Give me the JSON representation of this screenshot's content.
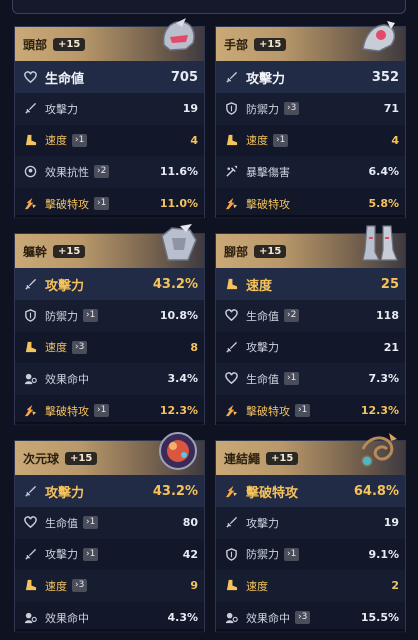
{
  "colors": {
    "gold": "#f6c35b",
    "main_bg": "#222b45",
    "card_bg": "#171d31"
  },
  "cards": [
    {
      "slot": "頭部",
      "level": "+15",
      "relic_icon": "helmet-icon",
      "main": {
        "icon": "heart-icon",
        "name": "生命値",
        "value": "705",
        "gold": false
      },
      "subs": [
        {
          "icon": "sword-icon",
          "name": "攻擊力",
          "roll": "",
          "value": "19",
          "gold": false
        },
        {
          "icon": "boot-icon",
          "name": "速度",
          "roll": "›1",
          "value": "4",
          "gold": true
        },
        {
          "icon": "resist-icon",
          "name": "效果抗性",
          "roll": "›2",
          "value": "11.6%",
          "gold": false
        },
        {
          "icon": "break-icon",
          "name": "擊破特攻",
          "roll": "›1",
          "value": "11.0%",
          "gold": true
        }
      ]
    },
    {
      "slot": "手部",
      "level": "+15",
      "relic_icon": "gauntlet-icon",
      "main": {
        "icon": "sword-icon",
        "name": "攻擊力",
        "value": "352",
        "gold": false
      },
      "subs": [
        {
          "icon": "shield-icon",
          "name": "防禦力",
          "roll": "›3",
          "value": "71",
          "gold": false
        },
        {
          "icon": "boot-icon",
          "name": "速度",
          "roll": "›1",
          "value": "4",
          "gold": true
        },
        {
          "icon": "crit-icon",
          "name": "暴擊傷害",
          "roll": "",
          "value": "6.4%",
          "gold": false
        },
        {
          "icon": "break-icon",
          "name": "擊破特攻",
          "roll": "",
          "value": "5.8%",
          "gold": true
        }
      ]
    },
    {
      "slot": "軀幹",
      "level": "+15",
      "relic_icon": "armor-icon",
      "main": {
        "icon": "sword-icon",
        "name": "攻擊力",
        "value": "43.2%",
        "gold": true
      },
      "subs": [
        {
          "icon": "shield-icon",
          "name": "防禦力",
          "roll": "›1",
          "value": "10.8%",
          "gold": false
        },
        {
          "icon": "boot-icon",
          "name": "速度",
          "roll": "›3",
          "value": "8",
          "gold": true
        },
        {
          "icon": "hit-icon",
          "name": "效果命中",
          "roll": "",
          "value": "3.4%",
          "gold": false
        },
        {
          "icon": "break-icon",
          "name": "擊破特攻",
          "roll": "›1",
          "value": "12.3%",
          "gold": true
        }
      ]
    },
    {
      "slot": "腳部",
      "level": "+15",
      "relic_icon": "boots-icon",
      "main": {
        "icon": "boot-icon",
        "name": "速度",
        "value": "25",
        "gold": true
      },
      "subs": [
        {
          "icon": "heart-icon",
          "name": "生命值",
          "roll": "›2",
          "value": "118",
          "gold": false
        },
        {
          "icon": "sword-icon",
          "name": "攻擊力",
          "roll": "",
          "value": "21",
          "gold": false
        },
        {
          "icon": "heart-icon",
          "name": "生命值",
          "roll": "›1",
          "value": "7.3%",
          "gold": false
        },
        {
          "icon": "break-icon",
          "name": "擊破特攻",
          "roll": "›1",
          "value": "12.3%",
          "gold": true
        }
      ]
    },
    {
      "slot": "次元球",
      "level": "+15",
      "relic_icon": "sphere-icon",
      "main": {
        "icon": "sword-icon",
        "name": "攻擊力",
        "value": "43.2%",
        "gold": true
      },
      "subs": [
        {
          "icon": "heart-icon",
          "name": "生命值",
          "roll": "›1",
          "value": "80",
          "gold": false
        },
        {
          "icon": "sword-icon",
          "name": "攻擊力",
          "roll": "›1",
          "value": "42",
          "gold": false
        },
        {
          "icon": "boot-icon",
          "name": "速度",
          "roll": "›3",
          "value": "9",
          "gold": true
        },
        {
          "icon": "hit-icon",
          "name": "效果命中",
          "roll": "",
          "value": "4.3%",
          "gold": false
        }
      ]
    },
    {
      "slot": "連結繩",
      "level": "+15",
      "relic_icon": "rope-icon",
      "main": {
        "icon": "break-icon",
        "name": "擊破特攻",
        "value": "64.8%",
        "gold": true
      },
      "subs": [
        {
          "icon": "sword-icon",
          "name": "攻擊力",
          "roll": "",
          "value": "19",
          "gold": false
        },
        {
          "icon": "shield-icon",
          "name": "防禦力",
          "roll": "›1",
          "value": "9.1%",
          "gold": false
        },
        {
          "icon": "boot-icon",
          "name": "速度",
          "roll": "",
          "value": "2",
          "gold": true
        },
        {
          "icon": "hit-icon",
          "name": "效果命中",
          "roll": "›3",
          "value": "15.5%",
          "gold": false
        }
      ]
    }
  ]
}
